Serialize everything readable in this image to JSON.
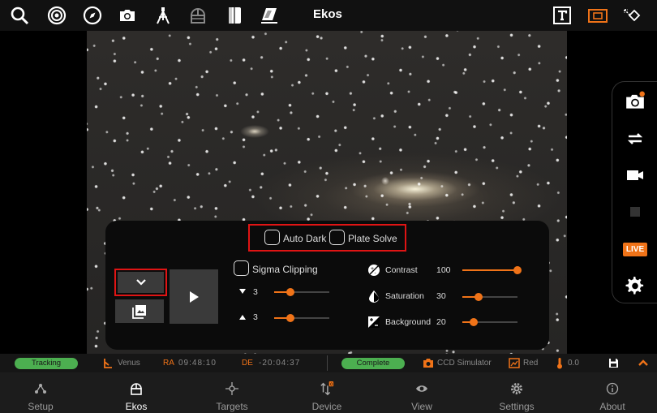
{
  "app": {
    "title": "Ekos"
  },
  "topbar": {
    "icons": [
      "search-icon",
      "target-icon",
      "compass-icon",
      "camera-icon",
      "tripod-icon",
      "observatory-icon",
      "notebook-icon",
      "flat-field-icon"
    ],
    "right_icons": [
      "text-overlay-icon",
      "frame-icon",
      "drag-icon"
    ],
    "accent": "#f07318"
  },
  "capture_panel": {
    "auto_dark": {
      "label": "Auto Dark",
      "checked": false
    },
    "plate_solve": {
      "label": "Plate Solve",
      "checked": false
    },
    "sigma_clipping": {
      "label": "Sigma Clipping",
      "checked": false
    },
    "sigma_low": "3",
    "sigma_high": "3",
    "contrast": {
      "label": "Contrast",
      "value": "100",
      "level": 1.0
    },
    "saturation": {
      "label": "Saturation",
      "value": "30",
      "level": 0.3
    },
    "background": {
      "label": "Background",
      "value": "20",
      "level": 0.2
    },
    "sigma_low_level": 0.3,
    "sigma_high_level": 0.3
  },
  "side_panel": {
    "live_label": "LIVE"
  },
  "status": {
    "tracking": "Tracking",
    "target": "Venus",
    "ra_label": "RA",
    "ra_value": "09:48:10",
    "de_label": "DE",
    "de_value": "-20:04:37",
    "complete": "Complete",
    "camera": "CCD Simulator",
    "filter": "Red",
    "temperature": "0.0"
  },
  "nav": [
    {
      "label": "Setup"
    },
    {
      "label": "Ekos"
    },
    {
      "label": "Targets"
    },
    {
      "label": "Device"
    },
    {
      "label": "View"
    },
    {
      "label": "Settings"
    },
    {
      "label": "About"
    }
  ]
}
